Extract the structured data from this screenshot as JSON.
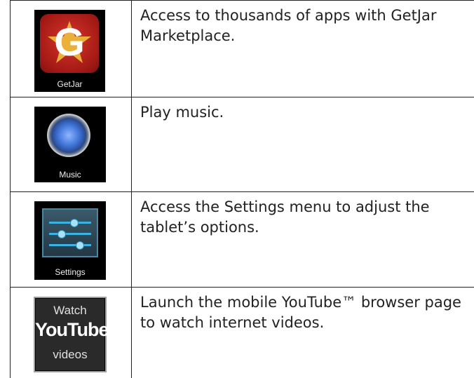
{
  "rows": [
    {
      "icon_name": "getjar-icon",
      "icon_label": "GetJar",
      "glyph": "G",
      "lines": [
        "Access to thousands of apps with GetJar",
        "Marketplace."
      ]
    },
    {
      "icon_name": "music-icon",
      "icon_label": "Music",
      "lines": [
        "Play music."
      ]
    },
    {
      "icon_name": "settings-icon",
      "icon_label": "Settings",
      "lines": [
        "Access the Settings menu to adjust the",
        "tablet’s options."
      ]
    },
    {
      "icon_name": "youtube-icon",
      "watch": "Watch",
      "logo": "YouTube",
      "videos": "videos",
      "lines": [
        "Launch the mobile YouTube™ browser page",
        "to watch internet videos."
      ]
    }
  ],
  "colors": {
    "getjar_red": "#b3201b",
    "music_blue": "#3f73d8",
    "settings_blue": "#39b3e6"
  }
}
